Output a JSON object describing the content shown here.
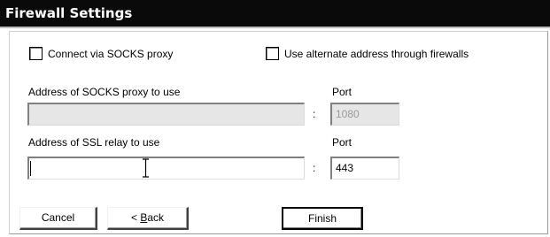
{
  "window": {
    "title": "Firewall Settings"
  },
  "options": {
    "socks_checkbox_label": "Connect via SOCKS proxy",
    "socks_checked": false,
    "alternate_checkbox_label": "Use alternate address through firewalls",
    "alternate_checked": false
  },
  "socks": {
    "address_label": "Address of SOCKS proxy to use",
    "address_value": "",
    "port_label": "Port",
    "port_value": "1080",
    "separator": ":"
  },
  "ssl": {
    "address_label": "Address of SSL relay to use",
    "address_value": "",
    "port_label": "Port",
    "port_value": "443",
    "separator": ":"
  },
  "buttons": {
    "cancel_label": "Cancel",
    "back_prefix": "< ",
    "back_mnemonic": "B",
    "back_rest": "ack",
    "finish_label": "Finish"
  },
  "colors": {
    "titlebar_bg": "#0a0a0a",
    "titlebar_fg": "#ffffff",
    "disabled_field_bg": "#e6e6e6",
    "disabled_text": "#9a9a9a"
  },
  "icons": {
    "text_cursor": "ibeam-cursor-icon"
  }
}
